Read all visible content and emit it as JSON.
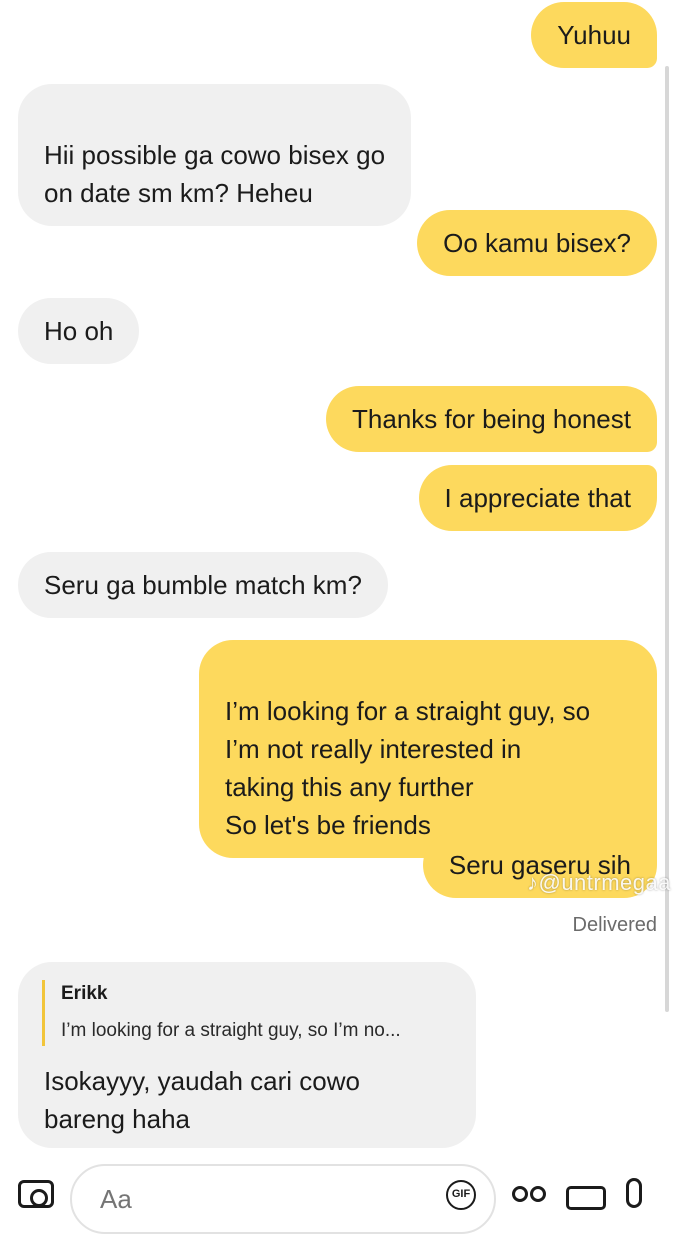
{
  "messages": [
    {
      "side": "out",
      "text": "Yuhuu"
    },
    {
      "side": "in",
      "text": "Hii possible ga cowo bisex go\non date sm km? Heheu"
    },
    {
      "side": "out",
      "text": "Oo kamu bisex?"
    },
    {
      "side": "in",
      "text": "Ho oh"
    },
    {
      "side": "out",
      "text": "Thanks for being honest"
    },
    {
      "side": "out",
      "text": "I appreciate that"
    },
    {
      "side": "in",
      "text": "Seru ga bumble match km?"
    },
    {
      "side": "out",
      "text": "I’m looking for a straight guy, so\nI’m not really interested in\ntaking this any further\nSo let's be friends"
    },
    {
      "side": "out",
      "text": "Seru gaseru sih"
    }
  ],
  "status": {
    "delivered": "Delivered"
  },
  "watermark": "♪@untrmegaa",
  "reply": {
    "quoted_name": "Erikk",
    "quoted_snippet": "I’m looking for a straight guy, so I’m no...",
    "text": "Isokayyy, yaudah cari cowo\nbareng haha"
  },
  "composer": {
    "placeholder": "Aa",
    "gif_label": "GIF",
    "icons": [
      "camera-icon",
      "gif-icon",
      "emoji-icon",
      "video-icon",
      "mic-icon"
    ]
  },
  "colors": {
    "outgoing_bubble": "#fdd95d",
    "incoming_bubble": "#f0f0f0",
    "reply_accent": "#f2c53a"
  }
}
